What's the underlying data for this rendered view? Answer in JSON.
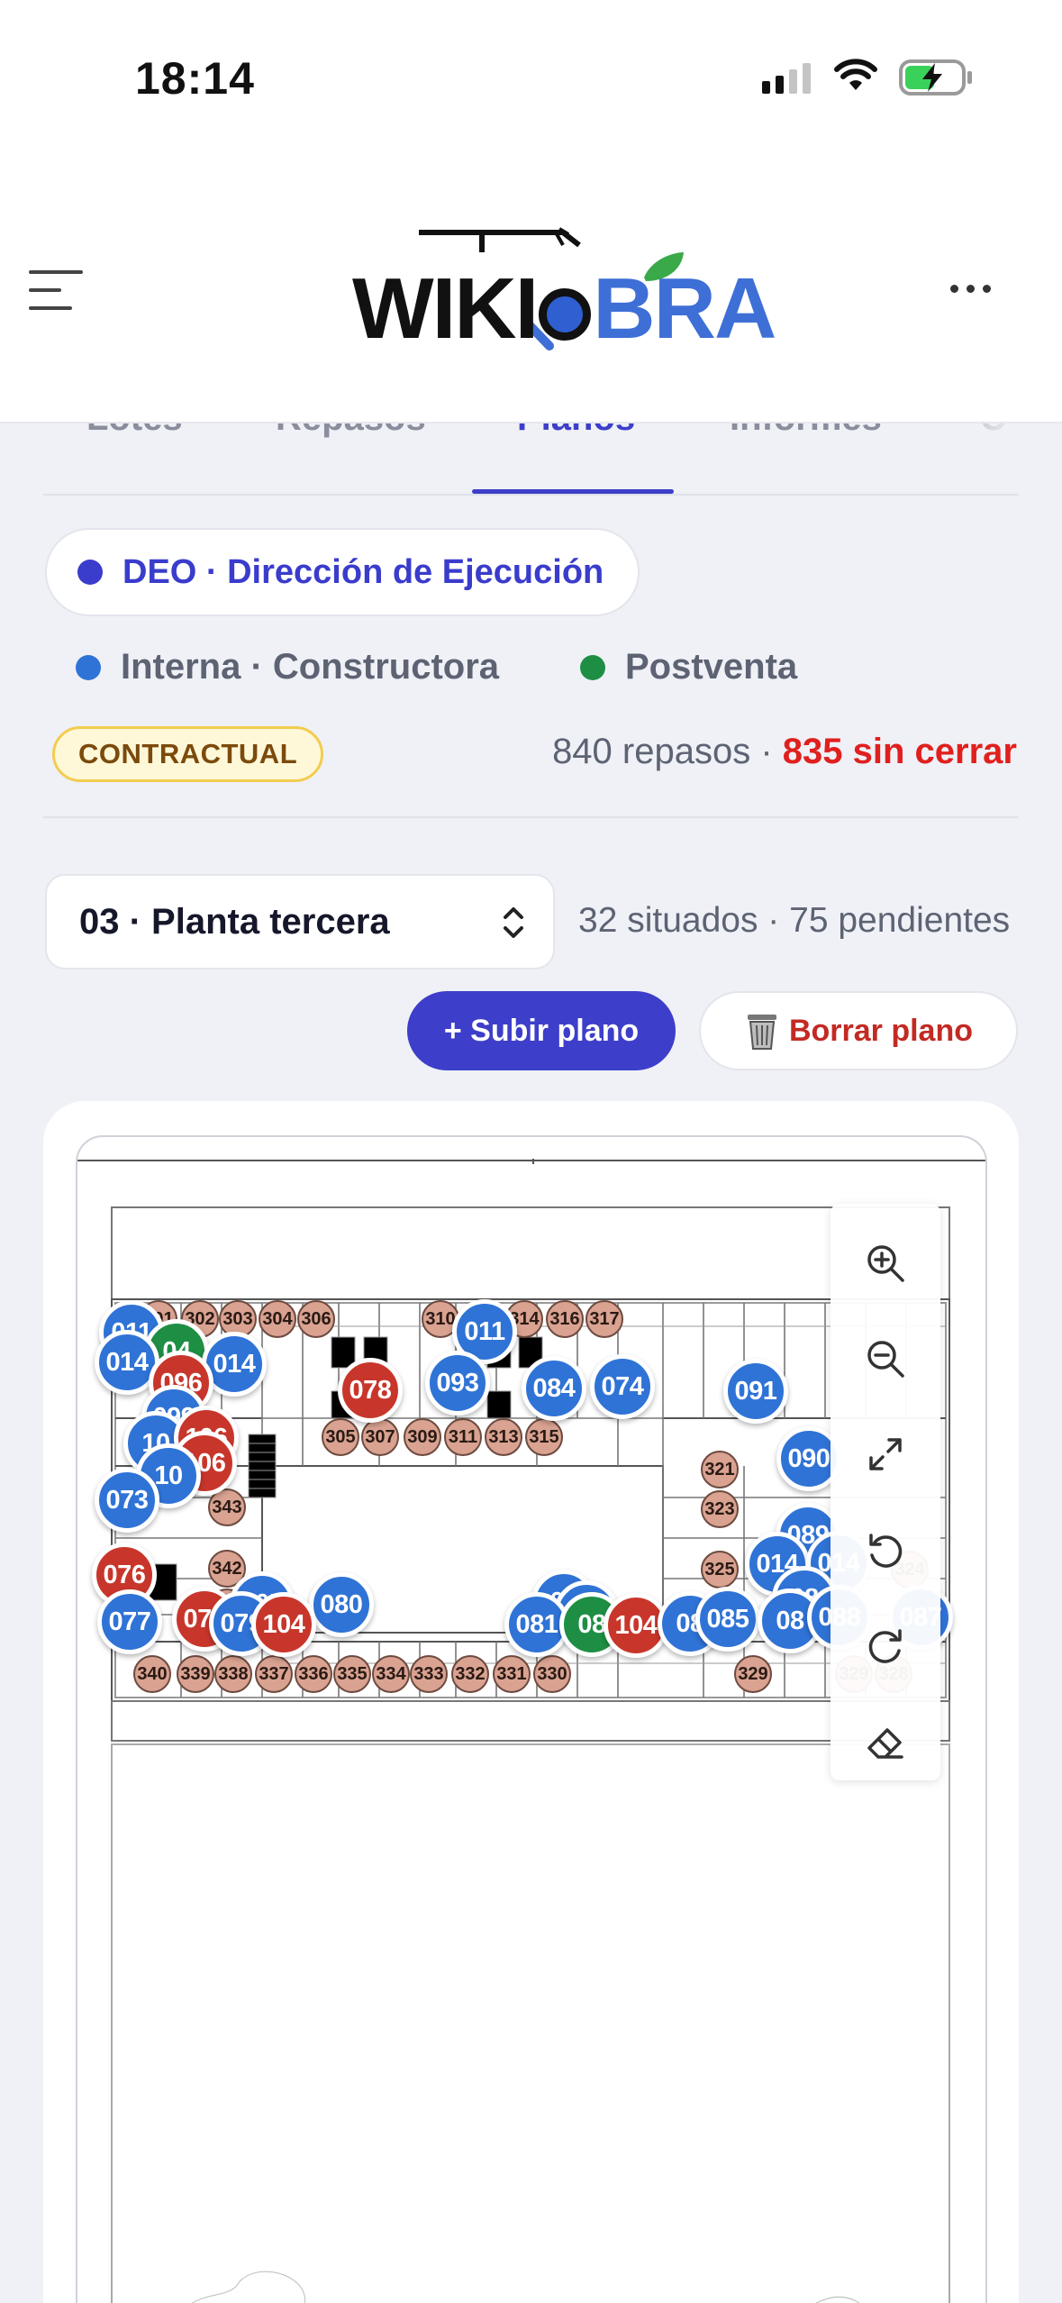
{
  "status_bar": {
    "time": "18:14"
  },
  "header": {
    "logo_text_left": "WIKI",
    "logo_text_right": "BRA",
    "menu_icon": "hamburger-icon",
    "more_icon": "ellipsis-icon"
  },
  "tabs": [
    {
      "label": "Lotes",
      "active": false
    },
    {
      "label": "Repasos",
      "active": false
    },
    {
      "label": "Planos",
      "active": true
    },
    {
      "label": "Informes",
      "active": false
    },
    {
      "label": "C",
      "active": false
    }
  ],
  "filters": {
    "deo": {
      "label": "DEO · Dirección de Ejecución",
      "color": "#3a3ccc"
    },
    "interna": {
      "label": "Interna · Constructora",
      "color": "#2f73d6"
    },
    "postventa": {
      "label": "Postventa",
      "color": "#1f8e45"
    }
  },
  "summary": {
    "badge": "CONTRACTUAL",
    "total": "840 repasos",
    "separator": "·",
    "open": "835 sin cerrar"
  },
  "floor": {
    "selected": "03 · Planta tercera",
    "situated": "32 situados · 75 pendientes"
  },
  "actions": {
    "upload": "+ Subir plano",
    "delete": "Borrar plano",
    "delete_icon": "trash-icon"
  },
  "zoom_tools": [
    "zoom-in-icon",
    "zoom-out-icon",
    "expand-icon",
    "rotate-left-icon",
    "rotate-right-icon",
    "eraser-icon"
  ],
  "room_labels": [
    "301",
    "302",
    "303",
    "304",
    "306",
    "310",
    "312",
    "314",
    "316",
    "317",
    "305",
    "307",
    "309",
    "311",
    "313",
    "315",
    "321",
    "323",
    "325",
    "327",
    "324",
    "326",
    "343",
    "342",
    "341",
    "340",
    "339",
    "338",
    "337",
    "336",
    "335",
    "334",
    "333",
    "332",
    "331",
    "330",
    "329",
    "328"
  ],
  "pins": [
    {
      "label": "011",
      "status": "interna"
    },
    {
      "label": "04",
      "status": "postventa"
    },
    {
      "label": "014",
      "status": "interna"
    },
    {
      "label": "014",
      "status": "interna"
    },
    {
      "label": "011",
      "status": "interna"
    },
    {
      "label": "096",
      "status": "deo"
    },
    {
      "label": "078",
      "status": "deo"
    },
    {
      "label": "093",
      "status": "interna"
    },
    {
      "label": "084",
      "status": "interna"
    },
    {
      "label": "074",
      "status": "interna"
    },
    {
      "label": "091",
      "status": "interna"
    },
    {
      "label": "099",
      "status": "interna"
    },
    {
      "label": "10",
      "status": "interna"
    },
    {
      "label": "106",
      "status": "deo"
    },
    {
      "label": "106",
      "status": "deo"
    },
    {
      "label": "10",
      "status": "interna"
    },
    {
      "label": "090",
      "status": "interna"
    },
    {
      "label": "073",
      "status": "interna"
    },
    {
      "label": "089",
      "status": "interna"
    },
    {
      "label": "014",
      "status": "interna"
    },
    {
      "label": "014",
      "status": "interna"
    },
    {
      "label": "076",
      "status": "deo"
    },
    {
      "label": "08",
      "status": "interna"
    },
    {
      "label": "077",
      "status": "interna"
    },
    {
      "label": "105",
      "status": "interna"
    },
    {
      "label": "080",
      "status": "interna"
    },
    {
      "label": "075",
      "status": "deo"
    },
    {
      "label": "079",
      "status": "interna"
    },
    {
      "label": "104",
      "status": "deo"
    },
    {
      "label": "08",
      "status": "interna"
    },
    {
      "label": "08",
      "status": "interna"
    },
    {
      "label": "081",
      "status": "interna"
    },
    {
      "label": "08",
      "status": "postventa"
    },
    {
      "label": "104",
      "status": "deo"
    },
    {
      "label": "08",
      "status": "interna"
    },
    {
      "label": "085",
      "status": "interna"
    },
    {
      "label": "08",
      "status": "interna"
    },
    {
      "label": "088",
      "status": "interna"
    },
    {
      "label": "087",
      "status": "interna"
    }
  ]
}
